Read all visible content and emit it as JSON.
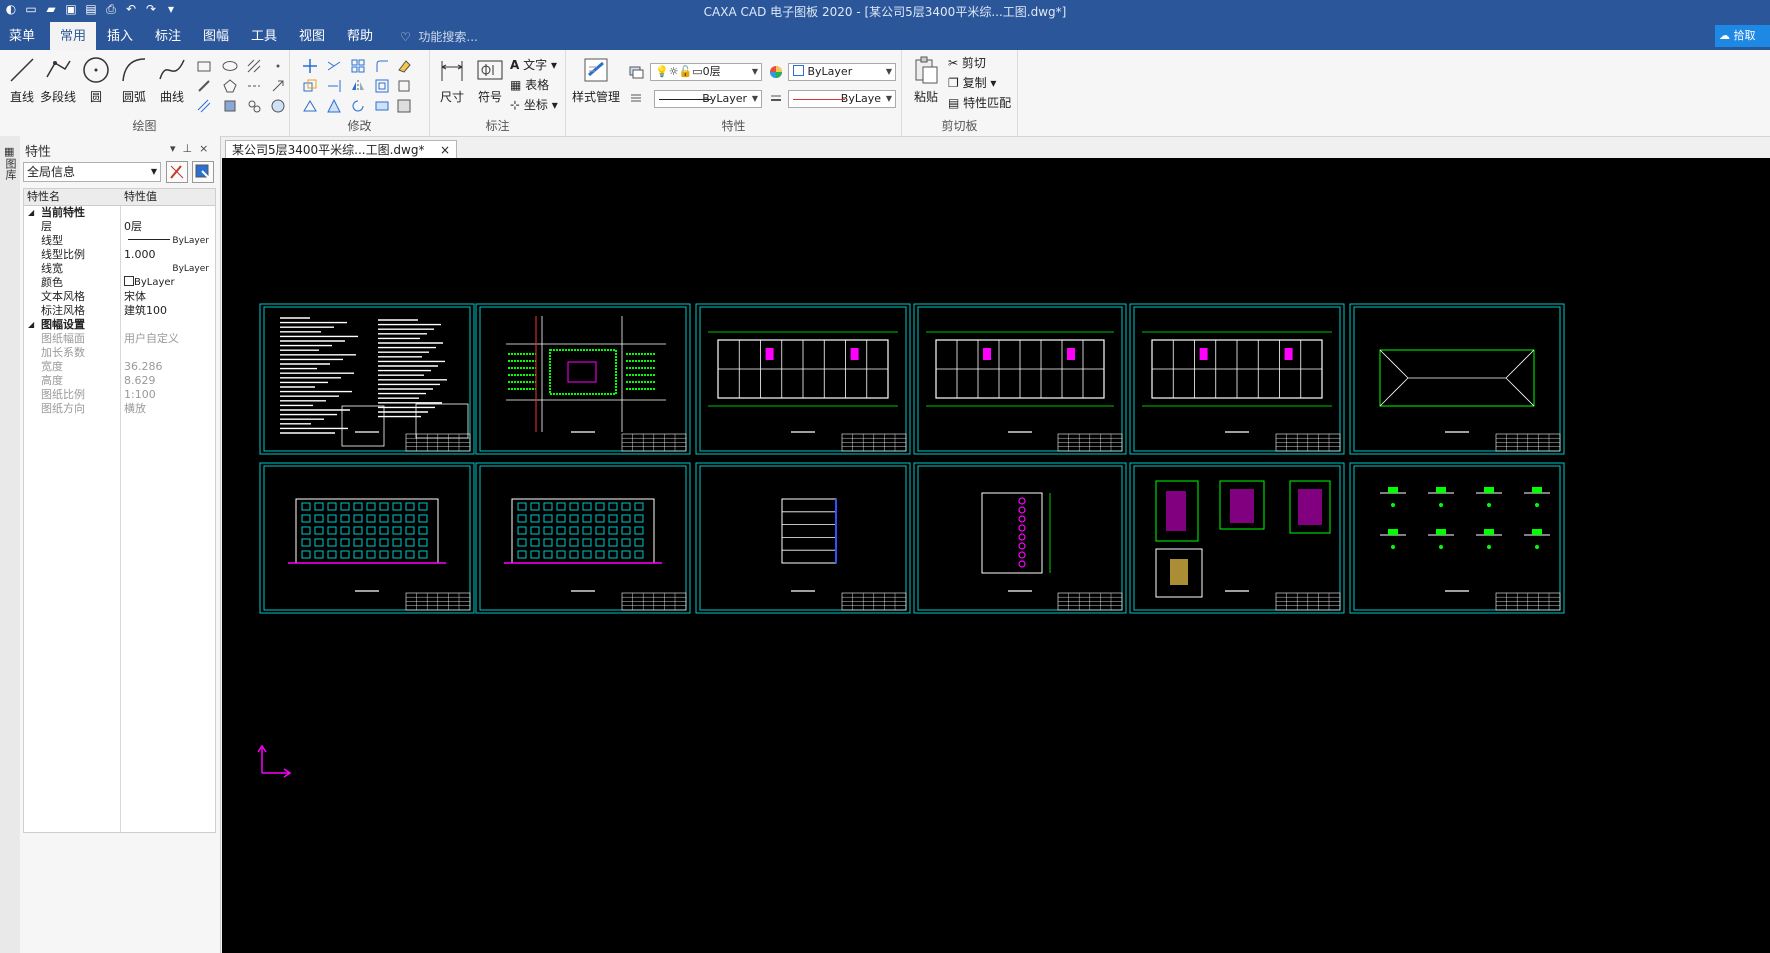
{
  "window": {
    "title": "CAXA CAD 电子图板 2020 - [某公司5层3400平米综...工图.dwg*]"
  },
  "menu": {
    "tabs": [
      "菜单",
      "常用",
      "插入",
      "标注",
      "图幅",
      "工具",
      "视图",
      "帮助"
    ],
    "active_tab": "常用",
    "search_placeholder": "功能搜索...",
    "cloud_label": "拾取"
  },
  "ribbon": {
    "draw": {
      "label": "绘图",
      "tools": [
        "直线",
        "多段线",
        "圆",
        "圆弧",
        "曲线"
      ]
    },
    "modify": {
      "label": "修改"
    },
    "annotate": {
      "label": "标注",
      "tools": [
        "尺寸",
        "符号"
      ],
      "small": [
        "文字",
        "表格",
        "坐标"
      ]
    },
    "properties": {
      "label": "特性",
      "style_manager": "样式管理",
      "layer_value": "0层",
      "color_value": "ByLayer",
      "linetype_value": "ByLayer",
      "lineweight_value": "ByLaye"
    },
    "clipboard": {
      "label": "剪切板",
      "paste": "粘贴",
      "small": [
        "剪切",
        "复制",
        "特性匹配"
      ]
    }
  },
  "side_strip": {
    "label": "图库"
  },
  "properties_panel": {
    "title": "特性",
    "scope": "全局信息",
    "columns": [
      "特性名",
      "特性值"
    ],
    "sections": [
      {
        "name": "当前特性",
        "rows": [
          {
            "k": "层",
            "v": "0层"
          },
          {
            "k": "线型",
            "v": "ByLayer"
          },
          {
            "k": "线型比例",
            "v": "1.000"
          },
          {
            "k": "线宽",
            "v": "ByLayer"
          },
          {
            "k": "颜色",
            "v": "ByLayer"
          },
          {
            "k": "文本风格",
            "v": "宋体"
          },
          {
            "k": "标注风格",
            "v": "建筑100"
          }
        ]
      },
      {
        "name": "图幅设置",
        "rows": [
          {
            "k": "图纸幅面",
            "v": "用户自定义"
          },
          {
            "k": "加长系数",
            "v": ""
          },
          {
            "k": "宽度",
            "v": "36.286"
          },
          {
            "k": "高度",
            "v": "8.629"
          },
          {
            "k": "图纸比例",
            "v": "1:100"
          },
          {
            "k": "图纸方向",
            "v": "横放"
          }
        ]
      }
    ]
  },
  "document": {
    "tab_label": "某公司5层3400平米综...工图.dwg*"
  },
  "colors": {
    "titlebar": "#2b579a",
    "canvas": "#000000",
    "frame": "#00c8c8",
    "drawing": "#00ff00",
    "accent": "#ff00ff",
    "white_lines": "#ffffff"
  },
  "sheets": [
    {
      "kind": "notes"
    },
    {
      "kind": "site"
    },
    {
      "kind": "plan"
    },
    {
      "kind": "plan"
    },
    {
      "kind": "plan"
    },
    {
      "kind": "roof"
    },
    {
      "kind": "elevation"
    },
    {
      "kind": "elevation"
    },
    {
      "kind": "section"
    },
    {
      "kind": "stair"
    },
    {
      "kind": "details"
    },
    {
      "kind": "nodes"
    }
  ]
}
